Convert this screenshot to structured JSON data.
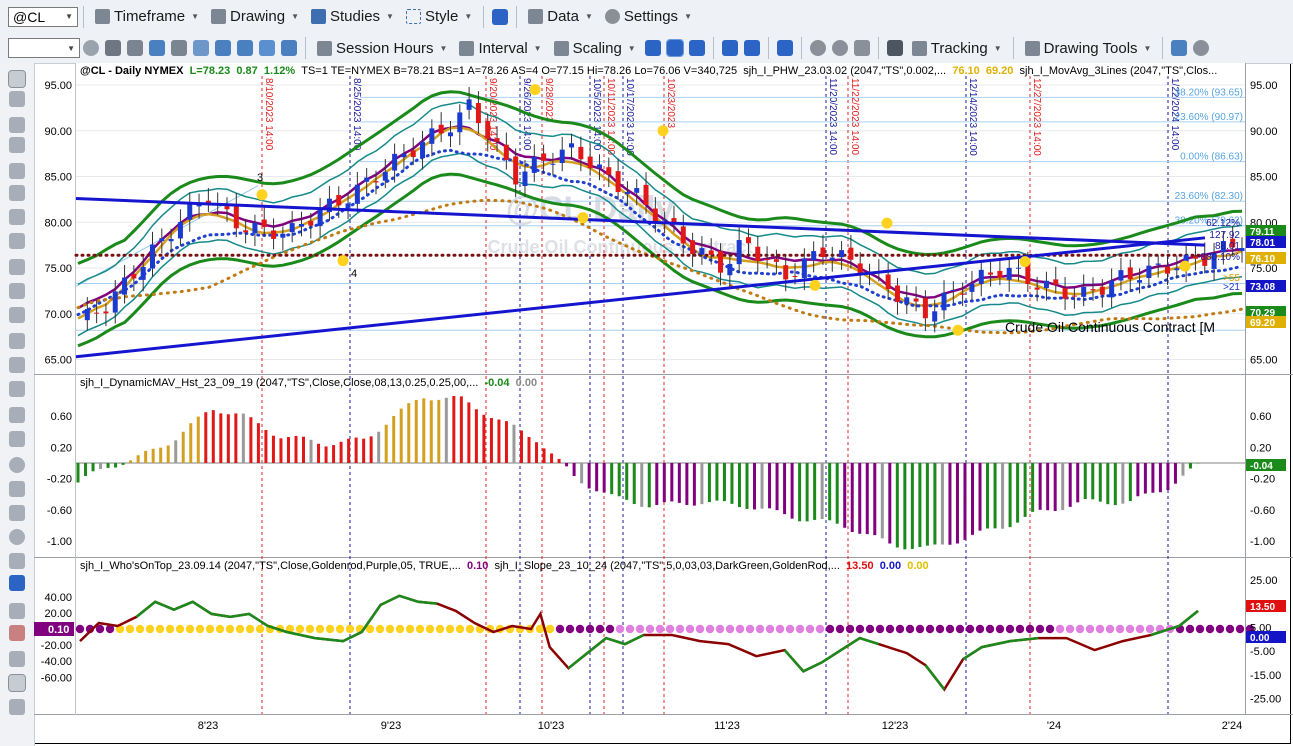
{
  "toolbar1": {
    "symbol": "@CL",
    "menus": [
      "Timeframe",
      "Drawing",
      "Studies",
      "Style",
      "Data",
      "Settings"
    ]
  },
  "toolbar2": {
    "menus": [
      "Session Hours",
      "Interval",
      "Scaling",
      "Tracking",
      "Drawing Tools"
    ]
  },
  "chart": {
    "price_header": {
      "symbol": "@CL - Daily  NYMEX",
      "L": "L=78.23",
      "chg": "0.87",
      "pct": "1.12%",
      "rest": "TS=1  TE=NYMEX  B=78.21  BS=1  A=78.26  AS=4  O=77.15  Hi=78.26  Lo=76.06  V=340,725",
      "study1": "sjh_I_PHW_23.03.02 (2047,\"TS\",0.002,...",
      "s1v1": "76.10",
      "s1v2": "69.20",
      "study2": "sjh_I_MovAvg_3Lines (2047,\"TS\",Clos..."
    },
    "osc_header": {
      "label": "sjh_I_DynamicMAV_Hst_23_09_19 (2047,\"TS\",Close,Close,08,13,0.25,0.25,00,...",
      "v1": "-0.04",
      "v2": "0.00"
    },
    "wot_header": {
      "label1": "sjh_I_Who'sOnTop_23.09.14 (2047,\"TS\",Close,Goldenrod,Purple,05,  TRUE,...",
      "v1": "0.10",
      "label2": "sjh_I_Slope_23_10_24 (2047,\"TS\",5,0,03,03,DarkGreen,GoldenRod,...",
      "v2": "13.50",
      "v3": "0.00",
      "v4": "0.00"
    },
    "watermark_title": "Crude Oil Continuous Contract [M",
    "watermark_big": "@CL Daily",
    "watermark_sub": "Crude Oil Continuous Contract",
    "price_axis": [
      "95.00",
      "90.00",
      "85.00",
      "80.00",
      "75.00",
      "70.00",
      "65.00"
    ],
    "osc_axis": [
      "0.60",
      "0.20",
      "-0.20",
      "-0.60",
      "-1.00"
    ],
    "osc_axis_left": [
      "0.60",
      "0.20",
      "-0.20",
      "-0.60",
      "-1.00"
    ],
    "wot_axis_right": [
      "25.00",
      "15.00",
      "5.00",
      "-5.00",
      "-15.00",
      "-25.00"
    ],
    "wot_axis_left": [
      "40.00",
      "20.00",
      "-20.00",
      "-40.00",
      "-60.00"
    ],
    "wot_left_badge": "0.10",
    "x_axis": [
      "8'23",
      "9'23",
      "10'23",
      "11'23",
      "12'23",
      "'24",
      "2'24"
    ],
    "fib_labels": [
      "38.20% (93.65)",
      "23.60% (90.97)",
      "0.00% (86.63)",
      "23.60% (82.30)",
      "38.20% (79.62)"
    ],
    "right_labels_blue": [
      "62.12%",
      "127.92",
      "88.01",
      "-880.10%",
      ">55",
      ">21"
    ],
    "price_badges": [
      {
        "text": "79.11",
        "color": "#1a8a1a"
      },
      {
        "text": "78.01",
        "color": "#1515c8"
      },
      {
        "text": "76.10",
        "color": "#e0b000"
      },
      {
        "text": "73.08",
        "color": "#1515c8"
      },
      {
        "text": "70.29",
        "color": "#1a8a1a"
      },
      {
        "text": "69.20",
        "color": "#e0b000"
      }
    ],
    "osc_badge": {
      "text": "-0.04",
      "color": "#1a8a1a"
    },
    "wot_badges": [
      {
        "text": "13.50",
        "color": "#e01010"
      },
      {
        "text": "0.00",
        "color": "#1515c8"
      }
    ],
    "event_lines": [
      {
        "label": "8/10/2023 14:00",
        "color": "red"
      },
      {
        "label": "8/25/2023 14:00",
        "color": "navy"
      },
      {
        "label": "9/20/2023 14:00",
        "color": "red"
      },
      {
        "label": "9/26/2023 14:00",
        "color": "navy"
      },
      {
        "label": "9/28/2023",
        "color": "red"
      },
      {
        "label": "10/5/2023 14:00",
        "color": "navy"
      },
      {
        "label": "10/11/2023 14:00",
        "color": "red"
      },
      {
        "label": "10/17/2023 14:00",
        "color": "navy"
      },
      {
        "label": "10/23/2023",
        "color": "red"
      },
      {
        "label": "11/20/2023 14:00",
        "color": "navy"
      },
      {
        "label": "11/22/2023 14:00",
        "color": "red"
      },
      {
        "label": "12/14/2023 14:00",
        "color": "navy"
      },
      {
        "label": "12/27/2023 14:00",
        "color": "red"
      },
      {
        "label": "1/22/2024 14:00",
        "color": "navy"
      }
    ],
    "wave_labels": [
      "3",
      "4"
    ]
  },
  "chart_data": {
    "type": "line",
    "title": "@CL - Daily  NYMEX",
    "ylim": [
      63,
      97
    ],
    "x": [
      "8'23",
      "9'23",
      "10'23",
      "11'23",
      "12'23",
      "'24",
      "2'24"
    ],
    "series": [
      {
        "name": "sjh_I_PHW_23.03.02",
        "values": [
          75,
          80,
          92,
          84,
          72,
          74,
          78
        ]
      }
    ]
  }
}
